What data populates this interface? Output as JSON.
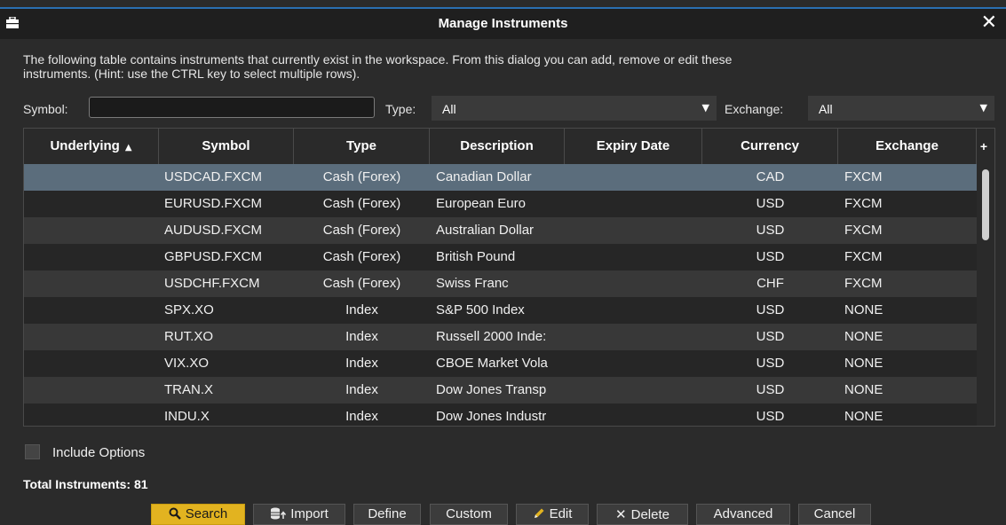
{
  "window": {
    "title": "Manage Instruments",
    "close": "✕"
  },
  "intro": {
    "line1": "The following table contains instruments that currently exist in the workspace.  From this dialog you can add, remove or edit these",
    "line2": "instruments. (Hint: use the CTRL key to select multiple rows)."
  },
  "filters": {
    "symbol_label": "Symbol:",
    "symbol_value": "",
    "type_label": "Type:",
    "type_value": "All",
    "exchange_label": "Exchange:",
    "exchange_value": "All"
  },
  "table": {
    "columns": [
      "Underlying",
      "Symbol",
      "Type",
      "Description",
      "Expiry Date",
      "Currency",
      "Exchange"
    ],
    "sort_indicator": "▲",
    "add_column": "+",
    "rows": [
      {
        "underlying": "",
        "symbol": "USDCAD.FXCM",
        "type": "Cash (Forex)",
        "description": "Canadian Dollar",
        "expiry": "",
        "currency": "CAD",
        "exchange": "FXCM"
      },
      {
        "underlying": "",
        "symbol": "EURUSD.FXCM",
        "type": "Cash (Forex)",
        "description": "European Euro",
        "expiry": "",
        "currency": "USD",
        "exchange": "FXCM"
      },
      {
        "underlying": "",
        "symbol": "AUDUSD.FXCM",
        "type": "Cash (Forex)",
        "description": "Australian Dollar",
        "expiry": "",
        "currency": "USD",
        "exchange": "FXCM"
      },
      {
        "underlying": "",
        "symbol": "GBPUSD.FXCM",
        "type": "Cash (Forex)",
        "description": "British Pound",
        "expiry": "",
        "currency": "USD",
        "exchange": "FXCM"
      },
      {
        "underlying": "",
        "symbol": "USDCHF.FXCM",
        "type": "Cash (Forex)",
        "description": "Swiss Franc",
        "expiry": "",
        "currency": "CHF",
        "exchange": "FXCM"
      },
      {
        "underlying": "",
        "symbol": "SPX.XO",
        "type": "Index",
        "description": "S&P 500 Index",
        "expiry": "",
        "currency": "USD",
        "exchange": "NONE"
      },
      {
        "underlying": "",
        "symbol": "RUT.XO",
        "type": "Index",
        "description": "Russell 2000 Inde:",
        "expiry": "",
        "currency": "USD",
        "exchange": "NONE"
      },
      {
        "underlying": "",
        "symbol": "VIX.XO",
        "type": "Index",
        "description": "CBOE Market Vola",
        "expiry": "",
        "currency": "USD",
        "exchange": "NONE"
      },
      {
        "underlying": "",
        "symbol": "TRAN.X",
        "type": "Index",
        "description": "Dow Jones Transp",
        "expiry": "",
        "currency": "USD",
        "exchange": "NONE"
      },
      {
        "underlying": "",
        "symbol": "INDU.X",
        "type": "Index",
        "description": "Dow Jones Industr",
        "expiry": "",
        "currency": "USD",
        "exchange": "NONE"
      }
    ],
    "selected_row": 0
  },
  "options": {
    "include_options_label": "Include Options",
    "include_options_checked": false,
    "total_label": "Total Instruments: 81"
  },
  "buttons": {
    "search": "Search",
    "import": "Import",
    "define": "Define",
    "custom": "Custom",
    "edit": "Edit",
    "delete": "Delete",
    "advanced": "Advanced",
    "cancel": "Cancel"
  },
  "colors": {
    "accent": "#e2b320",
    "selected_row": "#5b6d7c",
    "title_border": "#2a6fb2"
  }
}
